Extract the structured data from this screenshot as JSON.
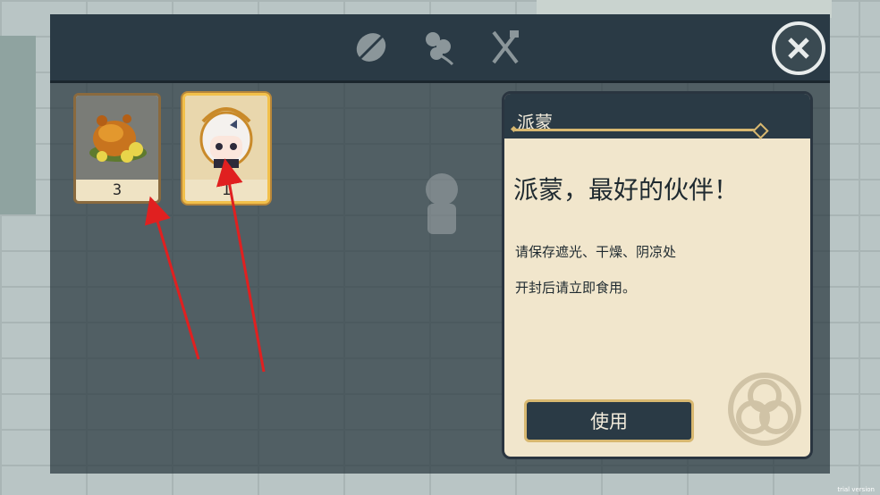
{
  "tabs": [
    {
      "icon": "leaf-icon"
    },
    {
      "icon": "flower-icon"
    },
    {
      "icon": "fork-knife-icon"
    }
  ],
  "close": {
    "icon": "close-icon"
  },
  "inventory": [
    {
      "icon": "roast-chicken-icon",
      "count": "3",
      "selected": false
    },
    {
      "icon": "paimon-icon",
      "count": "1",
      "selected": true
    }
  ],
  "detail": {
    "name": "派蒙",
    "title": "派蒙，最好的伙伴！",
    "desc_line1": "请保存遮光、干燥、阴凉处",
    "desc_line2": "开封后请立即食用。",
    "use_label": "使用",
    "emblem_icon": "knot-emblem-icon"
  },
  "watermark": "trial version",
  "colors": {
    "panel_dark": "#2a3a45",
    "panel_cream": "#f1e6cc",
    "gold": "#d8b870",
    "annotation_arrow": "#e02020"
  }
}
